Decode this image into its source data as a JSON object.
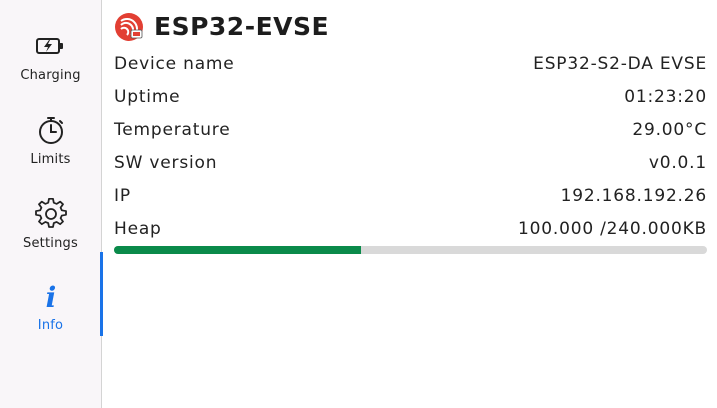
{
  "sidebar": {
    "items": [
      {
        "label": "Charging",
        "icon": "battery-charging-icon",
        "active": false
      },
      {
        "label": "Limits",
        "icon": "timer-icon",
        "active": false
      },
      {
        "label": "Settings",
        "icon": "gear-icon",
        "active": false
      },
      {
        "label": "Info",
        "icon": "info-icon",
        "active": true
      }
    ]
  },
  "header": {
    "title": "ESP32-EVSE",
    "logo_icon": "espressif-logo-icon",
    "logo_color": "#e23f33"
  },
  "info": {
    "rows": [
      {
        "key": "Device name",
        "value": "ESP32-S2-DA EVSE"
      },
      {
        "key": "Uptime",
        "value": "01:23:20"
      },
      {
        "key": "Temperature",
        "value": "29.00°C"
      },
      {
        "key": "SW version",
        "value": "v0.0.1"
      },
      {
        "key": "IP",
        "value": "192.168.192.26"
      },
      {
        "key": "Heap",
        "value": "100.000 /240.000KB"
      }
    ],
    "heap_fraction": 0.4167,
    "heap_color": "#0a8a4a"
  },
  "colors": {
    "accent": "#1a73e8"
  }
}
